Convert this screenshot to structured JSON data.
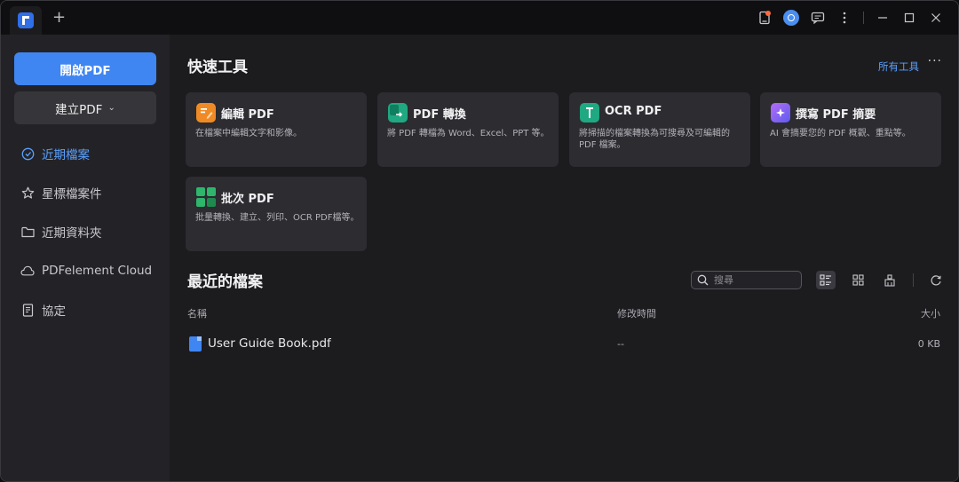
{
  "titlebar": {
    "new_tab": "+",
    "icons": [
      "book-icon",
      "user-avatar-icon",
      "feedback-icon",
      "more-vertical-icon",
      "minimize-icon",
      "maximize-icon",
      "close-icon"
    ]
  },
  "sidebar": {
    "open_pdf": "開啟PDF",
    "create_pdf": "建立PDF",
    "create_chevron": "⌄",
    "items": [
      {
        "label": "近期檔案",
        "icon": "clock-icon",
        "active": true
      },
      {
        "label": "星標檔案件",
        "icon": "star-icon",
        "active": false
      },
      {
        "label": "近期資料夾",
        "icon": "folder-icon",
        "active": false
      },
      {
        "label": "PDFelement Cloud",
        "icon": "cloud-icon",
        "active": false
      },
      {
        "label": "協定",
        "icon": "document-icon",
        "active": false
      }
    ]
  },
  "main": {
    "quick_tools_title": "快速工具",
    "all_tools": "所有工具",
    "more": "···",
    "tools": [
      {
        "title": "編輯 PDF",
        "desc": "在檔案中編輯文字和影像。",
        "icon": "edit-pdf-icon",
        "color": "#f08a24"
      },
      {
        "title": "PDF 轉換",
        "desc": "將 PDF 轉檔為 Word、Excel、PPT 等。",
        "icon": "convert-pdf-icon",
        "color": "#1fa882"
      },
      {
        "title": "OCR PDF",
        "desc": "將掃描的檔案轉換為可搜尋及可編輯的 PDF 檔案。",
        "icon": "ocr-pdf-icon",
        "color": "#1fa882"
      },
      {
        "title": "撰寫 PDF 摘要",
        "desc": "AI 會摘要您的 PDF 概觀、重點等。",
        "icon": "summarize-pdf-icon",
        "color": "#8a5cf0"
      },
      {
        "title": "批次 PDF",
        "desc": "批量轉換、建立、列印、OCR PDF檔等。",
        "icon": "batch-pdf-icon",
        "color": "#2db66c"
      }
    ],
    "recent_title": "最近的檔案",
    "search_placeholder": "搜尋",
    "columns": {
      "name": "名稱",
      "modified": "修改時間",
      "size": "大小"
    },
    "files": [
      {
        "name": "User Guide Book.pdf",
        "modified": "--",
        "size": "0 KB"
      }
    ]
  }
}
